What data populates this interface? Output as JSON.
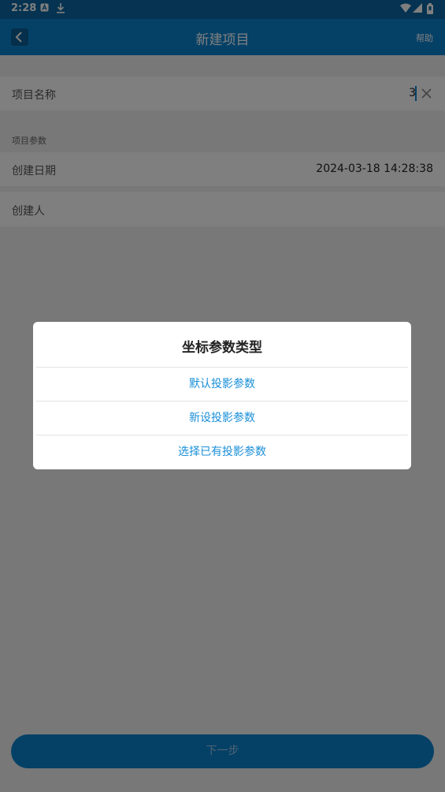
{
  "status_bar": {
    "time": "2:28"
  },
  "toolbar": {
    "title": "新建项目",
    "help_label": "帮助"
  },
  "form": {
    "project_name_label": "项目名称",
    "project_name_value": "3",
    "section_label": "项目参数",
    "create_date_label": "创建日期",
    "create_date_value": "2024-03-18 14:28:38",
    "creator_label": "创建人"
  },
  "footer": {
    "next_label": "下一步"
  },
  "dialog": {
    "title": "坐标参数类型",
    "options": [
      {
        "label": "默认投影参数"
      },
      {
        "label": "新设投影参数"
      },
      {
        "label": "选择已有投影参数"
      }
    ]
  },
  "colors": {
    "toolbar": "#0b82cf",
    "status_bar": "#0a67a3",
    "accent_text": "#1a8fd8"
  },
  "icons": [
    "notification-a-icon",
    "download-icon",
    "wifi-icon",
    "signal-icon",
    "battery-icon",
    "back-arrow-icon",
    "clear-icon"
  ]
}
